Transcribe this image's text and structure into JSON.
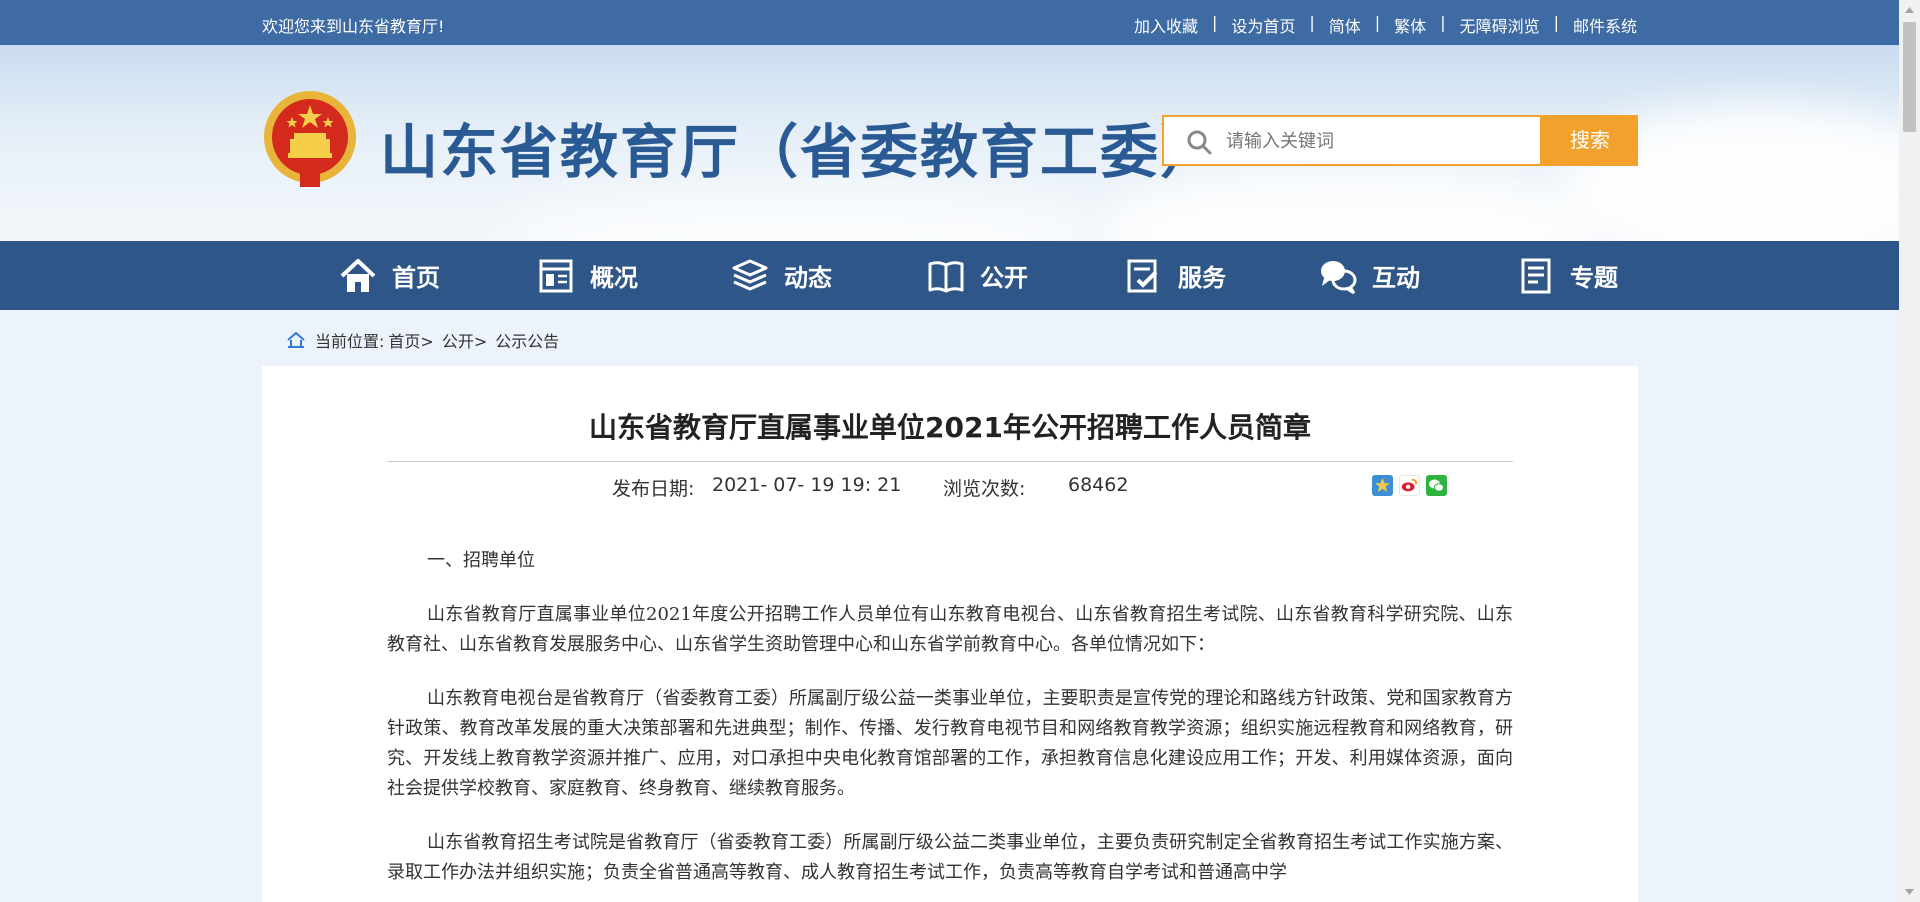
{
  "topbar": {
    "welcome": "欢迎您来到山东省教育厅!",
    "links": [
      "加入收藏",
      "设为首页",
      "简体",
      "繁体",
      "无障碍浏览",
      "邮件系统"
    ],
    "separator": "|"
  },
  "header": {
    "title": "山东省教育厅（省委教育工委）",
    "search_placeholder": "请输入关键词",
    "search_button": "搜索"
  },
  "nav": [
    {
      "label": "首页",
      "icon": "home-icon"
    },
    {
      "label": "概况",
      "icon": "overview-icon"
    },
    {
      "label": "动态",
      "icon": "news-icon"
    },
    {
      "label": "公开",
      "icon": "book-icon"
    },
    {
      "label": "服务",
      "icon": "service-icon"
    },
    {
      "label": "互动",
      "icon": "chat-icon"
    },
    {
      "label": "专题",
      "icon": "topic-icon"
    }
  ],
  "breadcrumb": {
    "prefix": "当前位置:",
    "items": [
      "首页>",
      "公开>",
      "公示公告"
    ]
  },
  "article": {
    "title": "山东省教育厅直属事业单位2021年公开招聘工作人员简章",
    "date_label": "发布日期:",
    "date": "2021- 07- 19 19: 21",
    "views_label": "浏览次数:",
    "views": "68462",
    "paragraphs": [
      "一、招聘单位",
      "山东省教育厅直属事业单位2021年度公开招聘工作人员单位有山东教育电视台、山东省教育招生考试院、山东省教育科学研究院、山东教育社、山东省教育发展服务中心、山东省学生资助管理中心和山东省学前教育中心。各单位情况如下：",
      "山东教育电视台是省教育厅（省委教育工委）所属副厅级公益一类事业单位，主要职责是宣传党的理论和路线方针政策、党和国家教育方针政策、教育改革发展的重大决策部署和先进典型；制作、传播、发行教育电视节目和网络教育教学资源；组织实施远程教育和网络教育，研究、开发线上教育教学资源并推广、应用，对口承担中央电化教育馆部署的工作，承担教育信息化建设应用工作；开发、利用媒体资源，面向社会提供学校教育、家庭教育、终身教育、继续教育服务。",
      "山东省教育招生考试院是省教育厅（省委教育工委）所属副厅级公益二类事业单位，主要负责研究制定全省教育招生考试工作实施方案、录取工作办法并组织实施；负责全省普通高等教育、成人教育招生考试工作，负责高等教育自学考试和普通高中学"
    ]
  },
  "colors": {
    "topbar": "#3e6ba3",
    "navbar": "#2f5689",
    "accent": "#f2a22c",
    "title_blue": "#2a5a94"
  }
}
